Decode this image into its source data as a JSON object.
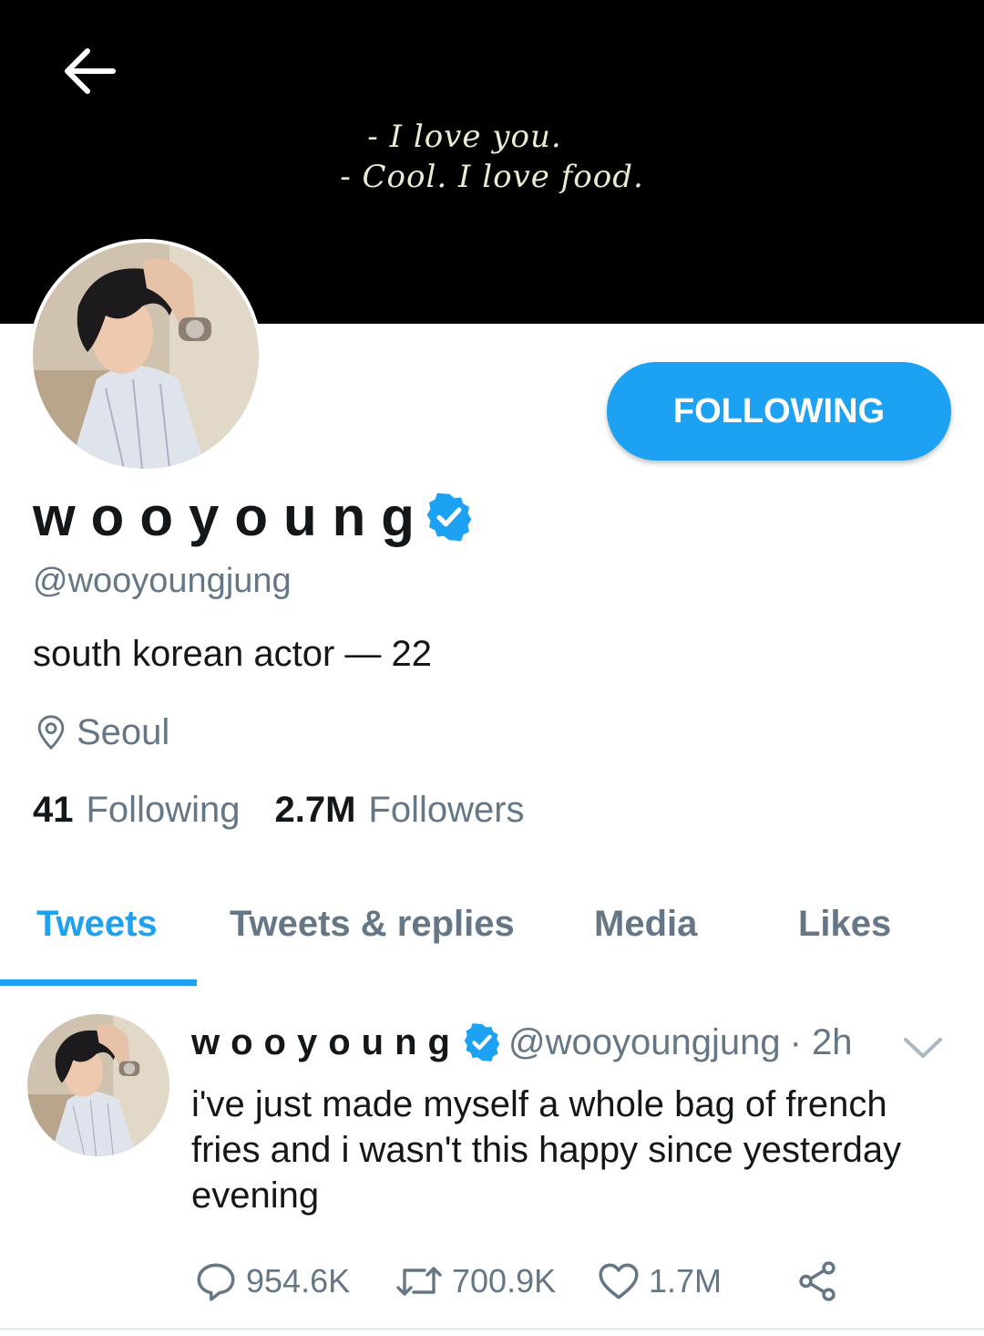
{
  "banner": {
    "subtitle_line1": "- I love you.",
    "subtitle_line2": "- Cool. I love food."
  },
  "profile": {
    "display_name": "wooyoung",
    "handle": "@wooyoungjung",
    "bio": "south korean actor — 22",
    "location": "Seoul",
    "following_count": "41",
    "following_label": "Following",
    "followers_count": "2.7M",
    "followers_label": "Followers",
    "follow_button_label": "FOLLOWING",
    "verified": true
  },
  "tabs": [
    {
      "label": "Tweets",
      "active": true
    },
    {
      "label": "Tweets & replies",
      "active": false
    },
    {
      "label": "Media",
      "active": false
    },
    {
      "label": "Likes",
      "active": false
    }
  ],
  "tweet": {
    "author_name": "wooyoung",
    "author_handle": "@wooyoungjung",
    "time": "· 2h",
    "text": "i've just made myself a whole bag of french fries and i wasn't this happy since yesterday evening",
    "replies": "954.6K",
    "retweets": "700.9K",
    "likes": "1.7M"
  },
  "colors": {
    "accent": "#1da1f2",
    "secondary_text": "#657786",
    "primary_text": "#14171a",
    "banner_bg": "#000000"
  },
  "icons": [
    "back-arrow-icon",
    "verified-badge-icon",
    "location-pin-icon",
    "chevron-down-icon",
    "reply-icon",
    "retweet-icon",
    "like-heart-icon",
    "share-icon"
  ]
}
